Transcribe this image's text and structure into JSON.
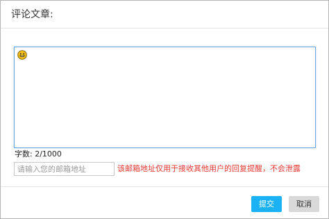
{
  "dialog": {
    "title": "评论文章:"
  },
  "comment": {
    "emoji_icon": "smiley-face-icon",
    "char_count_label": "字数: 2/1000"
  },
  "email": {
    "placeholder": "请输入您的邮箱地址",
    "value": "",
    "hint": "该邮箱地址仅用于接收其他用户的回复提醒，不会泄露"
  },
  "footer": {
    "submit_label": "提交",
    "cancel_label": "取消"
  },
  "colors": {
    "submit_bg": "#1ab2f4",
    "cancel_bg": "#d9d9d9",
    "hint_text": "#e53935",
    "focus_border": "#6ea7e0"
  }
}
